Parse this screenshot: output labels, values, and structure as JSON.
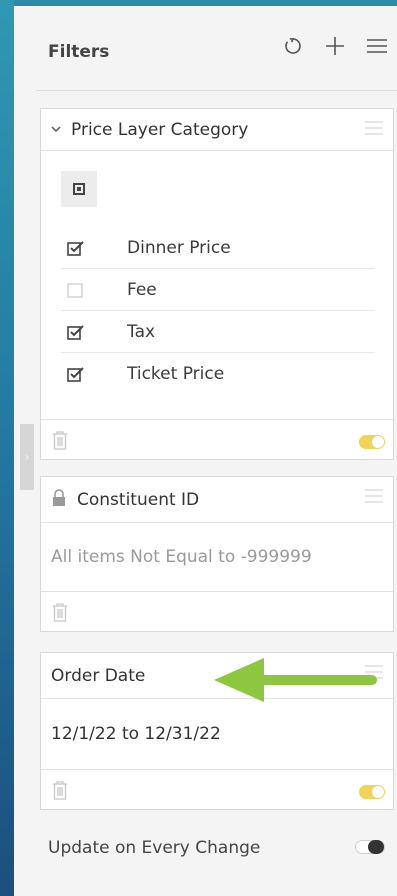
{
  "header": {
    "title": "Filters",
    "icons": [
      "reset-icon",
      "add-icon",
      "menu-icon"
    ]
  },
  "filters": [
    {
      "title": "Price Layer Category",
      "expanded": true,
      "options": [
        {
          "label": "Dinner Price",
          "checked": true
        },
        {
          "label": "Fee",
          "checked": false
        },
        {
          "label": "Tax",
          "checked": true
        },
        {
          "label": "Ticket Price",
          "checked": true
        }
      ],
      "enabled": true
    },
    {
      "title": "Constituent ID",
      "locked": true,
      "summary": "All items Not Equal to -999999"
    },
    {
      "title": "Order Date",
      "summary": "12/1/22 to 12/31/22",
      "enabled": true
    }
  ],
  "footer": {
    "update_label": "Update on Every Change",
    "update_enabled": false
  },
  "colors": {
    "toggle_on": "#f1d35a",
    "arrow": "#8dc63f"
  }
}
